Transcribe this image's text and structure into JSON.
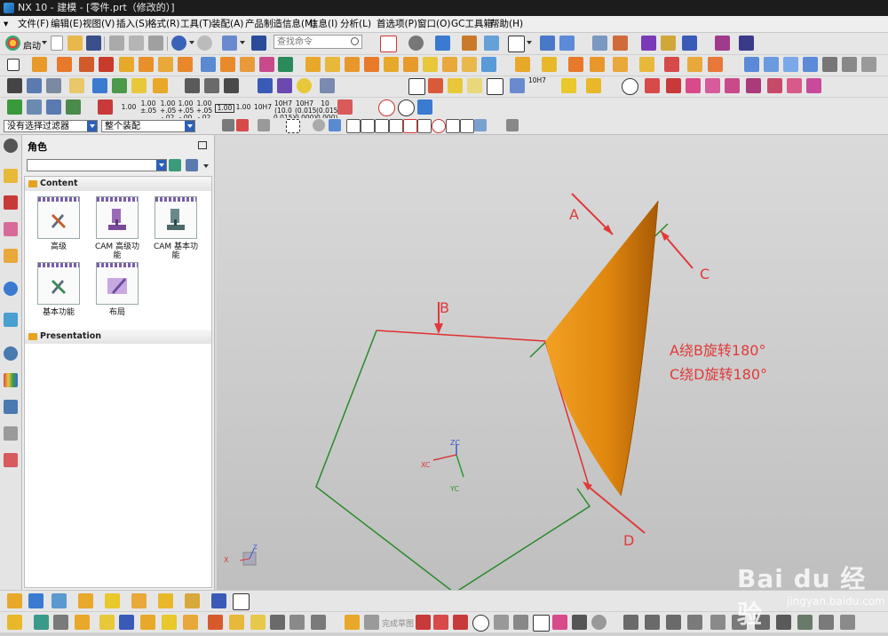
{
  "window": {
    "title": "NX 10 - 建模 - [零件.prt（修改的）]"
  },
  "menu": [
    "文件(F)",
    "编辑(E)",
    "视图(V)",
    "插入(S)",
    "格式(R)",
    "工具(T)",
    "装配(A)",
    "产品制造信息(M)",
    "信息(I)",
    "分析(L)",
    "首选项(P)",
    "窗口(O)",
    "GC工具箱",
    "帮助(H)"
  ],
  "toolbar": {
    "start_label": "启动",
    "search_placeholder": "查找命令",
    "tolerance_labels": [
      "1.00",
      "1.00 ±.05",
      "1.00 +.05 -.02",
      "1.00 +.05 -.00",
      "1.00 +.05 -.02",
      "1.00",
      "1.00",
      "10H7",
      "10H7 (10.0 0.015)",
      "10H7 (0.015 0.000)",
      "10 (0.015 0.000)"
    ],
    "fit_label": "10H7"
  },
  "filter": {
    "selection_filter": "没有选择过滤器",
    "assembly_scope": "整个装配"
  },
  "panel": {
    "title": "角色",
    "sections": [
      {
        "name": "Content",
        "roles": [
          "高级",
          "CAM 高级功能",
          "CAM 基本功能",
          "基本功能",
          "布局"
        ]
      },
      {
        "name": "Presentation",
        "roles": []
      }
    ]
  },
  "viewport": {
    "labels": {
      "A": "A",
      "B": "B",
      "C": "C",
      "D": "D"
    },
    "annotation_lines": [
      "A绕B旋转180°",
      "C绕D旋转180°"
    ],
    "triad": {
      "xc": "XC",
      "yc": "YC",
      "zc": "ZC"
    },
    "view_triad": {
      "x": "X",
      "z": "Z"
    },
    "colors": {
      "annotation": "#e03a3a",
      "shape_fill": "#e88a10",
      "curve_green": "#2a8a2a",
      "curve_red": "#e03030",
      "background": "#cfcfcf"
    }
  },
  "bottom": {
    "sketch_label": "完成草图"
  },
  "watermark": {
    "brand": "Bai du 经验",
    "url": "jingyan.baidu.com"
  }
}
